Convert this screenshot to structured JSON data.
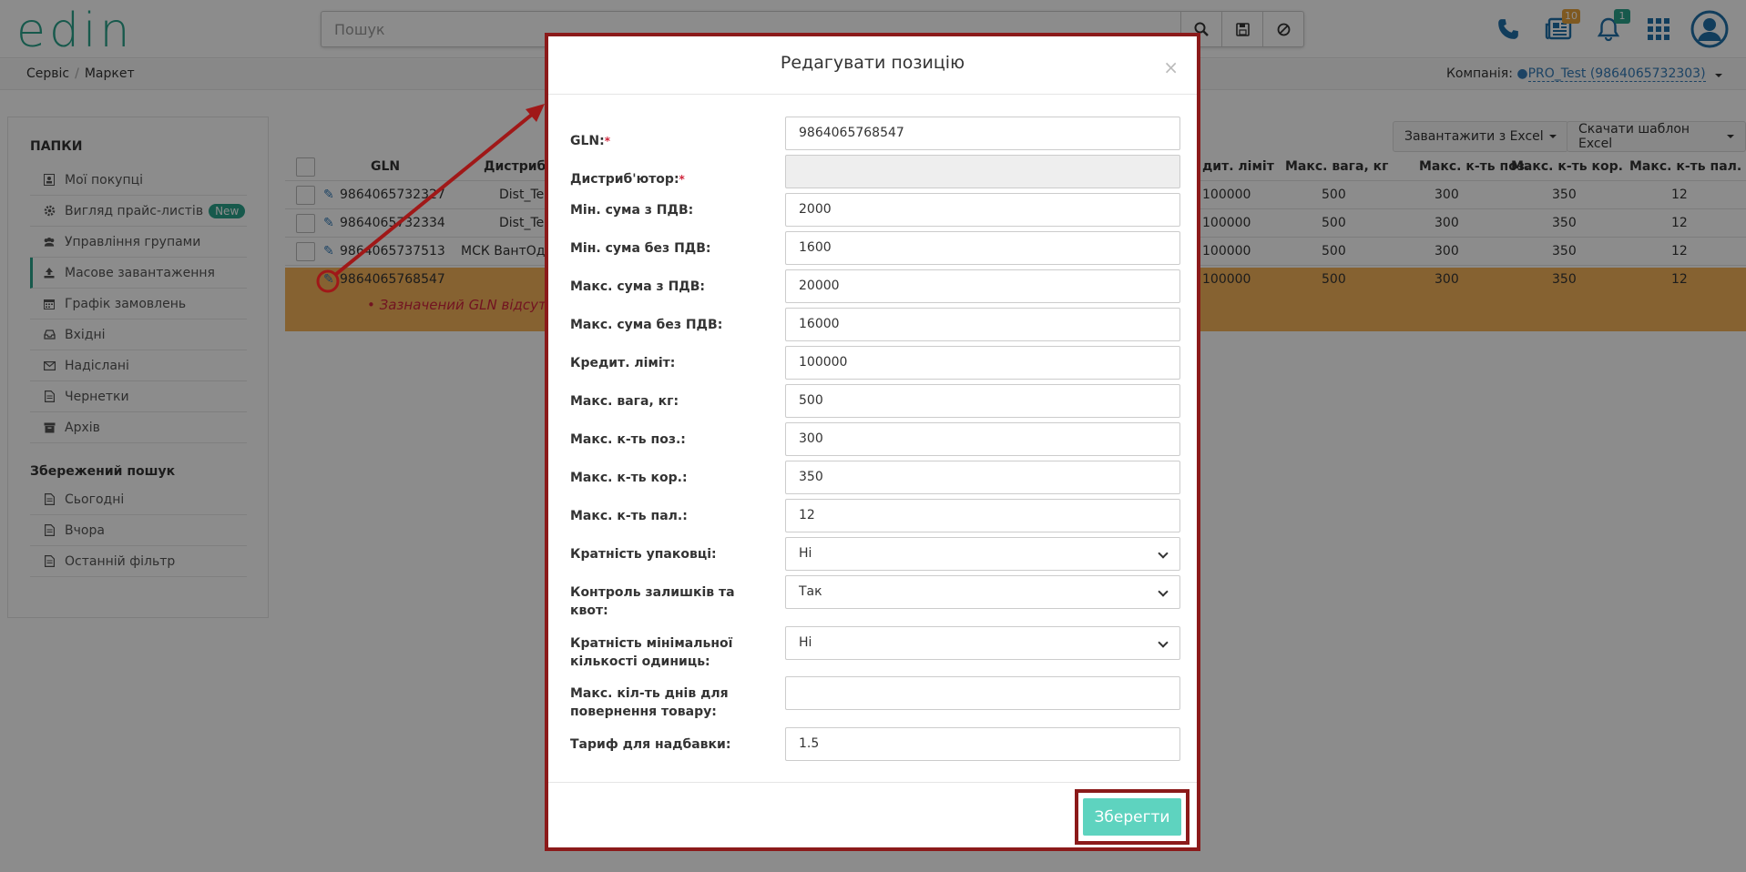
{
  "header": {
    "logo": "edin",
    "search_placeholder": "Пошук",
    "archive_badge": "10",
    "notif_badge": "1"
  },
  "breadcrumb": {
    "items": [
      "Сервіс",
      "Маркет"
    ]
  },
  "company": {
    "label": "Компанія:",
    "value": "PRO_Test (9864065732303)"
  },
  "sidebar": {
    "folders_title": "ПАПКИ",
    "items": [
      {
        "label": "Мої покупці",
        "icon": "user-card-icon"
      },
      {
        "label": "Вигляд прайс-листів",
        "icon": "gear-icon",
        "badge": "New"
      },
      {
        "label": "Управління групами",
        "icon": "users-icon"
      },
      {
        "label": "Масове завантаження",
        "icon": "upload-icon"
      },
      {
        "label": "Графік замовлень",
        "icon": "calendar-icon"
      },
      {
        "label": "Вхідні",
        "icon": "inbox-icon"
      },
      {
        "label": "Надіслані",
        "icon": "envelope-icon"
      },
      {
        "label": "Чернетки",
        "icon": "document-icon"
      },
      {
        "label": "Архів",
        "icon": "archive-icon"
      }
    ],
    "saved_title": "Збережений пошук",
    "saved": [
      {
        "label": "Сьогодні"
      },
      {
        "label": "Вчора"
      },
      {
        "label": "Останній фільтр"
      }
    ]
  },
  "toolbar": {
    "upload_excel": "Завантажити з Excel",
    "download_template": "Скачати шаблон Excel"
  },
  "table": {
    "headers": {
      "gln": "GLN",
      "distributor": "Дистриб",
      "credit": "дит. ліміт",
      "weight": "Макс. вага, кг",
      "positions": "Макс. к-ть поз.",
      "boxes": "Макс. к-ть кор.",
      "pallets": "Макс. к-ть пал."
    },
    "rows": [
      {
        "gln": "9864065732327",
        "dist": "Dist_Te",
        "credit": "100000",
        "weight": "500",
        "positions": "300",
        "boxes": "350",
        "pallets": "12"
      },
      {
        "gln": "9864065732334",
        "dist": "Dist_Te",
        "credit": "100000",
        "weight": "500",
        "positions": "300",
        "boxes": "350",
        "pallets": "12"
      },
      {
        "gln": "9864065737513",
        "dist": "МСК ВантОд",
        "credit": "100000",
        "weight": "500",
        "positions": "300",
        "boxes": "350",
        "pallets": "12"
      },
      {
        "gln": "9864065768547",
        "dist": "",
        "credit": "100000",
        "weight": "500",
        "positions": "300",
        "boxes": "350",
        "pallets": "12"
      }
    ],
    "error_message": "• Зазначений GLN відсутній у"
  },
  "modal": {
    "title": "Редагувати позицію",
    "close": "×",
    "fields": [
      {
        "label": "GLN:",
        "required": true,
        "value": "9864065768547"
      },
      {
        "label": "Дистриб'ютор:",
        "required": true,
        "value": "",
        "disabled": true
      },
      {
        "label": "Мін. сума з ПДВ:",
        "value": "2000"
      },
      {
        "label": "Мін. сума без ПДВ:",
        "value": "1600"
      },
      {
        "label": "Макс. сума з ПДВ:",
        "value": "20000"
      },
      {
        "label": "Макс. сума без ПДВ:",
        "value": "16000"
      },
      {
        "label": "Кредит. ліміт:",
        "value": "100000"
      },
      {
        "label": "Макс. вага, кг:",
        "value": "500"
      },
      {
        "label": "Макс. к-ть поз.:",
        "value": "300"
      },
      {
        "label": "Макс. к-ть кор.:",
        "value": "350"
      },
      {
        "label": "Макс. к-ть пал.:",
        "value": "12"
      },
      {
        "label": "Кратність упаковці:",
        "value": "Ні",
        "select": true
      },
      {
        "label": "Контроль залишків та квот:",
        "value": "Так",
        "select": true
      },
      {
        "label": "Кратність мінімальної кількості одиниць:",
        "value": "Ні",
        "select": true
      },
      {
        "label": "Макс. кіл-ть днів для повернення товару:",
        "value": ""
      },
      {
        "label": "Тариф для надбавки:",
        "value": "1.5"
      }
    ],
    "save_label": "Зберегти"
  },
  "colors": {
    "brand": "#2aa38b",
    "highlight_frame": "#8b1a1a",
    "error_row": "#f5b25a",
    "save_button": "#5ed3bf"
  }
}
